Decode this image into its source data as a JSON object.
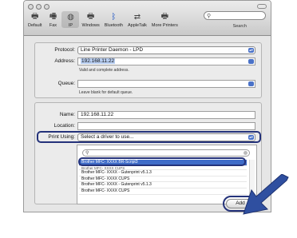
{
  "toolbar": {
    "items": [
      {
        "label": "Default",
        "icon": "printer-icon"
      },
      {
        "label": "Fax",
        "icon": "fax-icon"
      },
      {
        "label": "IP",
        "icon": "globe-icon",
        "selected": true
      },
      {
        "label": "Windows",
        "icon": "windows-printer-icon"
      },
      {
        "label": "Bluetooth",
        "icon": "bluetooth-icon"
      },
      {
        "label": "AppleTalk",
        "icon": "appletalk-icon"
      },
      {
        "label": "More Printers",
        "icon": "printer-icon"
      }
    ],
    "search_label": "Search"
  },
  "form": {
    "protocol_label": "Protocol:",
    "protocol_value": "Line Printer Daemon - LPD",
    "address_label": "Address:",
    "address_value": "192.168.11.22",
    "address_hint": "Valid and complete address.",
    "queue_label": "Queue:",
    "queue_value": "",
    "queue_hint": "Leave blank for default queue.",
    "name_label": "Name:",
    "name_value": "192.168.11.22",
    "location_label": "Location:",
    "location_value": "",
    "print_using_label": "Print Using:",
    "print_using_value": "Select a driver to use..."
  },
  "drivers": {
    "search_value": "",
    "items": [
      {
        "label": "Brother MFC- XXXX BR-Script3",
        "selected": true
      },
      {
        "label": "Brother MFC- XXXX CUPS",
        "partial": true
      },
      {
        "label": "Brother MFC- XXXX - Gutenprint v5.1.3"
      },
      {
        "label": "Brother MFC- XXXX CUPS"
      },
      {
        "label": "Brother MFC- XXXX - Gutenprint v5.1.3"
      },
      {
        "label": "Brother MFC- XXXX CUPS"
      }
    ]
  },
  "add_button": "Add",
  "colors": {
    "highlight": "#24327a",
    "selection": "#3f6cc8",
    "arrow": "#2f4fa0"
  }
}
